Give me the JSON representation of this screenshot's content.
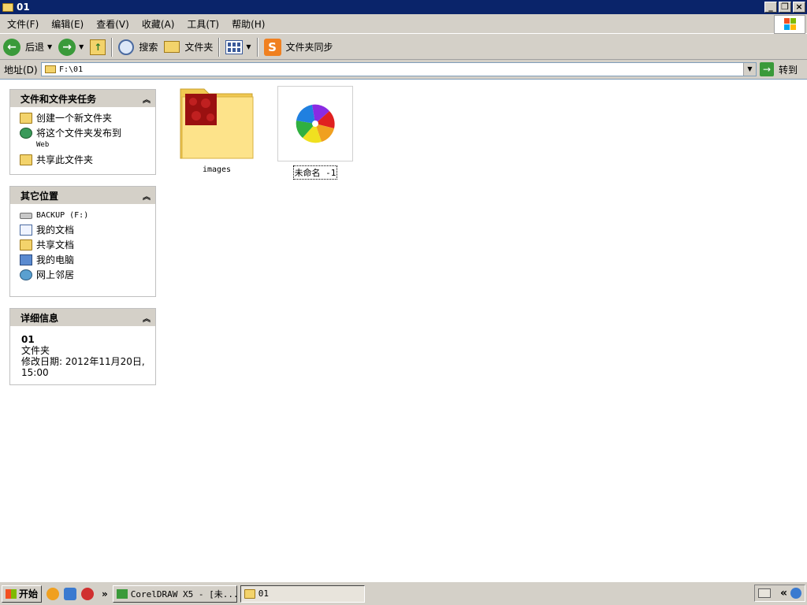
{
  "window": {
    "title": "01"
  },
  "menu": [
    "文件(F)",
    "编辑(E)",
    "查看(V)",
    "收藏(A)",
    "工具(T)",
    "帮助(H)"
  ],
  "toolbar": {
    "back": "后退",
    "search": "搜索",
    "folders": "文件夹",
    "sync": "文件夹同步"
  },
  "address": {
    "label": "地址(D)",
    "value": "F:\\01",
    "go": "转到"
  },
  "tasks_panel": {
    "title": "文件和文件夹任务",
    "items": [
      {
        "label": "创建一个新文件夹",
        "icon": "new-folder-icon"
      },
      {
        "label": "将这个文件夹发布到",
        "sub": "Web",
        "icon": "publish-web-icon"
      },
      {
        "label": "共享此文件夹",
        "icon": "share-folder-icon"
      }
    ]
  },
  "places_panel": {
    "title": "其它位置",
    "items": [
      {
        "label": "BACKUP (F:)",
        "icon": "drive-icon"
      },
      {
        "label": "我的文档",
        "icon": "my-documents-icon"
      },
      {
        "label": "共享文档",
        "icon": "shared-documents-icon"
      },
      {
        "label": "我的电脑",
        "icon": "my-computer-icon"
      },
      {
        "label": "网上邻居",
        "icon": "network-icon"
      }
    ]
  },
  "details_panel": {
    "title": "详细信息",
    "name": "01",
    "type": "文件夹",
    "modified": "修改日期: 2012年11月20日, 15:00"
  },
  "files": [
    {
      "name": "images",
      "kind": "folder"
    },
    {
      "name": "未命名 -1",
      "kind": "coreldraw-file"
    }
  ],
  "taskbar": {
    "start": "开始",
    "chevron": "»",
    "buttons": [
      {
        "label": "CorelDRAW X5 - [未...",
        "active": false
      },
      {
        "label": "01",
        "active": true
      }
    ],
    "tray_chevron": "«"
  },
  "colors": {
    "titlebar": "#0a246a",
    "face": "#d4d0c8",
    "folder": "#f3d36b"
  }
}
